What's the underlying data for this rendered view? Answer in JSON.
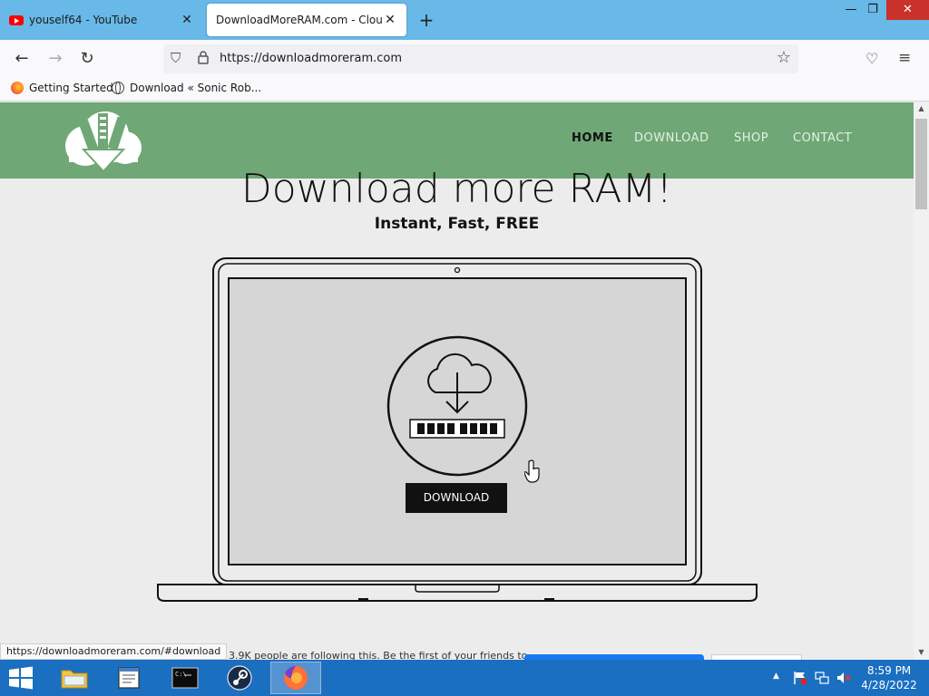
{
  "browser": {
    "tabs": [
      {
        "label": "youself64 - YouTube",
        "active": false
      },
      {
        "label": "DownloadMoreRAM.com - CloudRAM",
        "active": true
      }
    ],
    "new_tab_label": "+",
    "window_controls": {
      "minimize": "—",
      "restore": "❐",
      "close": "✕"
    },
    "url": "https://downloadmoreram.com",
    "bookmarks": [
      "Getting Started",
      "Download « Sonic Rob..."
    ]
  },
  "site": {
    "nav": [
      "HOME",
      "DOWNLOAD",
      "SHOP",
      "CONTACT"
    ],
    "active_nav": "HOME",
    "header_color": "#6fa776",
    "title": "Download more RAM!",
    "subtitle": "Instant, Fast, FREE",
    "download_button": "DOWNLOAD"
  },
  "status_bar": {
    "link": "https://downloadmoreram.com/#download",
    "follow_text": "3.9K people are following this. Be the first of your friends to"
  },
  "taskbar": {
    "apps": [
      "file-explorer",
      "notepad",
      "command-prompt",
      "steam",
      "firefox"
    ],
    "active_app": "firefox",
    "time": "8:59 PM",
    "date": "4/28/2022"
  }
}
